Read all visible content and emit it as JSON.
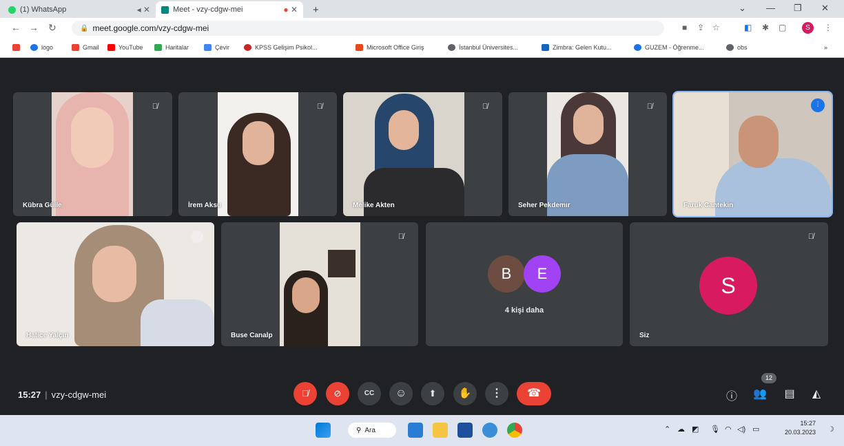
{
  "browser": {
    "tabs": [
      {
        "title": "(1) WhatsApp",
        "active": false
      },
      {
        "title": "Meet - vzy-cdgw-mei",
        "active": true
      }
    ],
    "new_tab_label": "+",
    "url": "meet.google.com/vzy-cdgw-mei",
    "profile_initial": "S",
    "bookmarks": [
      {
        "label": "logo"
      },
      {
        "label": "Gmail"
      },
      {
        "label": "YouTube"
      },
      {
        "label": "Haritalar"
      },
      {
        "label": "Çevir"
      },
      {
        "label": "KPSS Gelişim Psikol..."
      },
      {
        "label": "Microsoft Office Giriş"
      },
      {
        "label": "İstanbul Üniversites..."
      },
      {
        "label": "Zimbra: Gelen Kutu..."
      },
      {
        "label": "GUZEM - Öğrenme..."
      },
      {
        "label": "obs"
      }
    ],
    "bookmarks_overflow": "»"
  },
  "meet": {
    "participants_row1": [
      {
        "name": "Kübra Gülle"
      },
      {
        "name": "İrem Aksu"
      },
      {
        "name": "Melike Akten"
      },
      {
        "name": "Seher Pekdemır"
      },
      {
        "name": "Faruk Cantekin",
        "speaking": true
      }
    ],
    "participants_row2": [
      {
        "name": "Hatice Yalçın"
      },
      {
        "name": "Buse Canalp"
      }
    ],
    "more_tile": {
      "avatar1": "B",
      "avatar2": "E",
      "label": "4 kişi daha"
    },
    "self_tile": {
      "avatar": "S",
      "name": "Siz"
    },
    "time": "15:27",
    "meeting_code": "vzy-cdgw-mei",
    "participant_count": "12"
  },
  "taskbar": {
    "search_label": "Ara",
    "time": "15:27",
    "date": "20.03.2023"
  },
  "colors": {
    "meet_bg": "#202124",
    "tile_bg": "#3c4043",
    "hangup_red": "#ea4335",
    "avatar_b": "#6d4c41",
    "avatar_e": "#a142f4",
    "avatar_s": "#d81b60"
  }
}
